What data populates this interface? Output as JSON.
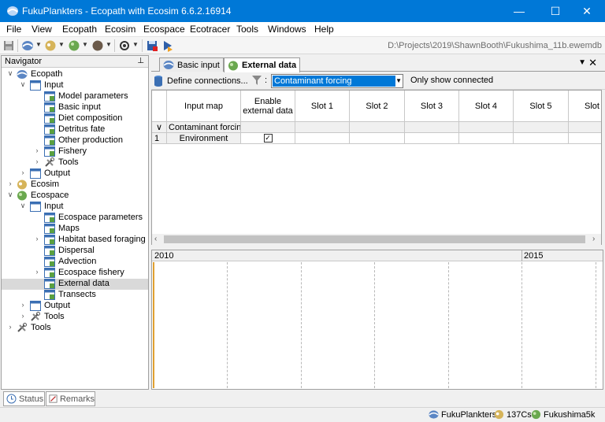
{
  "window": {
    "title": "FukuPlankters - Ecopath with Ecosim 6.6.2.16914",
    "minimize": "—",
    "maximize": "☐",
    "close": "✕"
  },
  "menu": [
    "File",
    "View",
    "Ecopath",
    "Ecosim",
    "Ecospace",
    "Ecotracer",
    "Tools",
    "Windows",
    "Help"
  ],
  "toolbar": {
    "path": "D:\\Projects\\2019\\ShawnBooth\\Fukushima_11b.ewemdb"
  },
  "navigator": {
    "title": "Navigator",
    "pin": "📌",
    "items": [
      {
        "label": "Ecopath"
      },
      {
        "label": "Input"
      },
      {
        "label": "Model parameters"
      },
      {
        "label": "Basic input"
      },
      {
        "label": "Diet composition"
      },
      {
        "label": "Detritus fate"
      },
      {
        "label": "Other production"
      },
      {
        "label": "Fishery"
      },
      {
        "label": "Tools"
      },
      {
        "label": "Output"
      },
      {
        "label": "Ecosim"
      },
      {
        "label": "Ecospace"
      },
      {
        "label": "Input"
      },
      {
        "label": "Ecospace parameters"
      },
      {
        "label": "Maps"
      },
      {
        "label": "Habitat based foraging"
      },
      {
        "label": "Dispersal"
      },
      {
        "label": "Advection"
      },
      {
        "label": "Ecospace fishery"
      },
      {
        "label": "External data"
      },
      {
        "label": "Transects"
      },
      {
        "label": "Output"
      },
      {
        "label": "Tools"
      },
      {
        "label": "Tools"
      }
    ]
  },
  "navtabs": {
    "status": "Status",
    "remarks": "Remarks"
  },
  "doctabs": {
    "basic_input": "Basic input",
    "external_data": "External data",
    "menu_arrow": "▼",
    "close": "✕"
  },
  "filterbar": {
    "define_connections": "Define connections...",
    "colon": ":",
    "selected": "Contaminant forcing",
    "only_show_connected": "Only show connected"
  },
  "grid": {
    "headers": [
      "Input map",
      "Enable external data",
      "Slot 1",
      "Slot 2",
      "Slot 3",
      "Slot 4",
      "Slot 5",
      "Slot"
    ],
    "group_label": "Contaminant forcing",
    "group_toggle": "∨",
    "row_index": "1",
    "row_name": "Environment",
    "row_checked": "✓"
  },
  "timeline": {
    "year_start": "2010",
    "year_end": "2015"
  },
  "statusbar": {
    "model": "FukuPlankters",
    "tracer": "137Cs",
    "scenario": "Fukushima5k"
  }
}
